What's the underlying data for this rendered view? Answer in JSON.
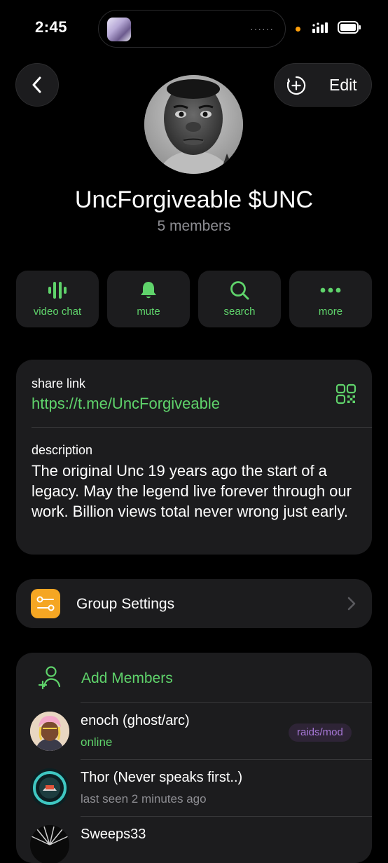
{
  "status_bar": {
    "time": "2:45",
    "island_indicator": "······"
  },
  "nav": {
    "edit_label": "Edit"
  },
  "group": {
    "name": "UncForgiveable $UNC",
    "members": "5 members"
  },
  "actions": [
    {
      "label": "video chat",
      "icon": "voice-chat-icon"
    },
    {
      "label": "mute",
      "icon": "bell-icon"
    },
    {
      "label": "search",
      "icon": "search-icon"
    },
    {
      "label": "more",
      "icon": "more-icon"
    }
  ],
  "info": {
    "share_title": "share link",
    "share_link": "https://t.me/UncForgiveable",
    "description_title": "description",
    "description": "The original Unc 19 years ago the start of a legacy. May the legend live forever through our work. Billion views total never wrong just early."
  },
  "settings": {
    "label": "Group Settings"
  },
  "members_list": {
    "add_label": "Add Members",
    "items": [
      {
        "name": "enoch (ghost/arc)",
        "status": "online",
        "badge": "raids/mod"
      },
      {
        "name": "Thor (Never speaks first..)",
        "status": "last seen 2 minutes ago"
      },
      {
        "name": "Sweeps33",
        "status": ""
      }
    ]
  },
  "colors": {
    "accent": "#5fd36b",
    "card": "#1c1c1e",
    "background": "#000000",
    "settings_icon": "#f5a623",
    "badge_text": "#a878d8"
  }
}
